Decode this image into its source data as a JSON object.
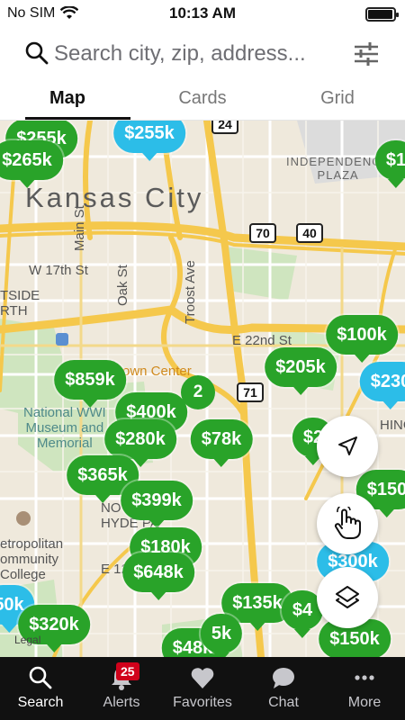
{
  "status_bar": {
    "carrier": "No SIM",
    "time": "10:13 AM"
  },
  "search": {
    "placeholder": "Search city, zip, address..."
  },
  "tabs": [
    {
      "label": "Map",
      "active": true
    },
    {
      "label": "Cards",
      "active": false
    },
    {
      "label": "Grid",
      "active": false
    }
  ],
  "map": {
    "place_labels": {
      "city": "Kansas City",
      "independence_plaza": "INDEPENDENCE\nPLAZA",
      "w17th": "W 17th St",
      "e22nd": "E 22nd St",
      "main_st": "Main St",
      "oak_st": "Oak St",
      "troost": "Troost Ave",
      "town_center": "own Center",
      "wwi_museum": "National WWI\nMuseum and\nMemorial",
      "north_hyde_park": "NO    H\nHYDE PA",
      "metro_cc": "etropolitan\nommunity\nCollege",
      "e12th": "E 12",
      "tside": "TSIDE\nRTH",
      "hing": "HING",
      "legal": "Legal"
    },
    "highway_shields": [
      "24",
      "70",
      "40",
      "71"
    ],
    "price_pins": [
      {
        "label": "$255k",
        "color": "green"
      },
      {
        "label": "$255k",
        "color": "blue"
      },
      {
        "label": "$265k",
        "color": "green"
      },
      {
        "label": "$1",
        "color": "green"
      },
      {
        "label": "$100k",
        "color": "green"
      },
      {
        "label": "$205k",
        "color": "green"
      },
      {
        "label": "$230",
        "color": "blue"
      },
      {
        "label": "$859k",
        "color": "green"
      },
      {
        "label": "$400k",
        "color": "green"
      },
      {
        "label": "$280k",
        "color": "green"
      },
      {
        "label": "$78k",
        "color": "green"
      },
      {
        "label": "$2",
        "color": "green"
      },
      {
        "label": "$365k",
        "color": "green"
      },
      {
        "label": "$399k",
        "color": "green"
      },
      {
        "label": "$150",
        "color": "green"
      },
      {
        "label": "$180k",
        "color": "green"
      },
      {
        "label": "$648k",
        "color": "green"
      },
      {
        "label": "$300k",
        "color": "blue"
      },
      {
        "label": "$135k",
        "color": "green"
      },
      {
        "label": "$4",
        "color": "green"
      },
      {
        "label": "50k",
        "color": "blue"
      },
      {
        "label": "$320k",
        "color": "green"
      },
      {
        "label": "$48k",
        "color": "green"
      },
      {
        "label": "5k",
        "color": "green"
      },
      {
        "label": "$150k",
        "color": "green"
      }
    ],
    "cluster_count": "2"
  },
  "bottom_nav": [
    {
      "label": "Search",
      "icon": "search-icon",
      "active": true
    },
    {
      "label": "Alerts",
      "icon": "bell-icon",
      "badge": "25"
    },
    {
      "label": "Favorites",
      "icon": "heart-icon"
    },
    {
      "label": "Chat",
      "icon": "chat-bubble-icon"
    },
    {
      "label": "More",
      "icon": "more-dots-icon"
    }
  ],
  "colors": {
    "pin_green": "#29a329",
    "pin_blue": "#2cbde8",
    "map_bg": "#efe9dc",
    "highway": "#f5c84c"
  }
}
